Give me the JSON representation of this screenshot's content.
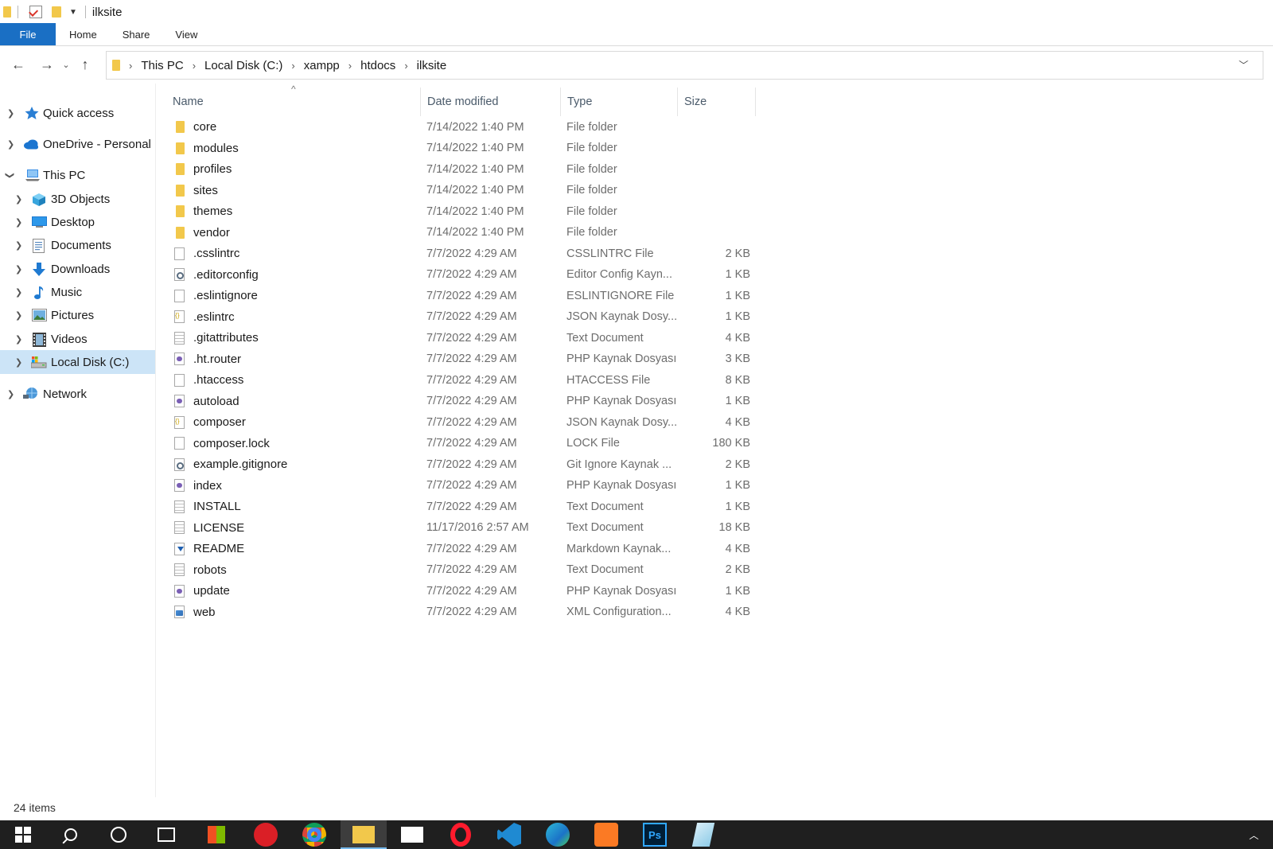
{
  "window": {
    "title": "ilksite"
  },
  "ribbon": {
    "tabs": [
      "File",
      "Home",
      "Share",
      "View"
    ]
  },
  "address": {
    "crumbs": [
      "This PC",
      "Local Disk (C:)",
      "xampp",
      "htdocs",
      "ilksite"
    ]
  },
  "sidebar": {
    "items": [
      {
        "label": "Quick access",
        "icon": "star-icon"
      },
      {
        "label": "OneDrive - Personal",
        "icon": "cloud-icon"
      },
      {
        "label": "This PC",
        "icon": "computer-icon"
      },
      {
        "label": "3D Objects",
        "icon": "cube-icon"
      },
      {
        "label": "Desktop",
        "icon": "desktop-icon"
      },
      {
        "label": "Documents",
        "icon": "documents-icon"
      },
      {
        "label": "Downloads",
        "icon": "download-icon"
      },
      {
        "label": "Music",
        "icon": "music-icon"
      },
      {
        "label": "Pictures",
        "icon": "pictures-icon"
      },
      {
        "label": "Videos",
        "icon": "videos-icon"
      },
      {
        "label": "Local Disk (C:)",
        "icon": "drive-icon"
      },
      {
        "label": "Network",
        "icon": "network-icon"
      }
    ],
    "selected": "Local Disk (C:)"
  },
  "list": {
    "columns": [
      "Name",
      "Date modified",
      "Type",
      "Size"
    ],
    "rows": [
      {
        "name": "core",
        "date": "7/14/2022 1:40 PM",
        "type": "File folder",
        "size": "",
        "icon": "folder"
      },
      {
        "name": "modules",
        "date": "7/14/2022 1:40 PM",
        "type": "File folder",
        "size": "",
        "icon": "folder"
      },
      {
        "name": "profiles",
        "date": "7/14/2022 1:40 PM",
        "type": "File folder",
        "size": "",
        "icon": "folder"
      },
      {
        "name": "sites",
        "date": "7/14/2022 1:40 PM",
        "type": "File folder",
        "size": "",
        "icon": "folder"
      },
      {
        "name": "themes",
        "date": "7/14/2022 1:40 PM",
        "type": "File folder",
        "size": "",
        "icon": "folder"
      },
      {
        "name": "vendor",
        "date": "7/14/2022 1:40 PM",
        "type": "File folder",
        "size": "",
        "icon": "folder"
      },
      {
        "name": ".csslintrc",
        "date": "7/7/2022 4:29 AM",
        "type": "CSSLINTRC File",
        "size": "2 KB",
        "icon": "file"
      },
      {
        "name": ".editorconfig",
        "date": "7/7/2022 4:29 AM",
        "type": "Editor Config Kayn...",
        "size": "1 KB",
        "icon": "gear"
      },
      {
        "name": ".eslintignore",
        "date": "7/7/2022 4:29 AM",
        "type": "ESLINTIGNORE File",
        "size": "1 KB",
        "icon": "file"
      },
      {
        "name": ".eslintrc",
        "date": "7/7/2022 4:29 AM",
        "type": "JSON Kaynak Dosy...",
        "size": "1 KB",
        "icon": "json"
      },
      {
        "name": ".gitattributes",
        "date": "7/7/2022 4:29 AM",
        "type": "Text Document",
        "size": "4 KB",
        "icon": "text"
      },
      {
        "name": ".ht.router",
        "date": "7/7/2022 4:29 AM",
        "type": "PHP Kaynak Dosyası",
        "size": "3 KB",
        "icon": "php"
      },
      {
        "name": ".htaccess",
        "date": "7/7/2022 4:29 AM",
        "type": "HTACCESS File",
        "size": "8 KB",
        "icon": "file"
      },
      {
        "name": "autoload",
        "date": "7/7/2022 4:29 AM",
        "type": "PHP Kaynak Dosyası",
        "size": "1 KB",
        "icon": "php"
      },
      {
        "name": "composer",
        "date": "7/7/2022 4:29 AM",
        "type": "JSON Kaynak Dosy...",
        "size": "4 KB",
        "icon": "json"
      },
      {
        "name": "composer.lock",
        "date": "7/7/2022 4:29 AM",
        "type": "LOCK File",
        "size": "180 KB",
        "icon": "file"
      },
      {
        "name": "example.gitignore",
        "date": "7/7/2022 4:29 AM",
        "type": "Git Ignore Kaynak ...",
        "size": "2 KB",
        "icon": "gear"
      },
      {
        "name": "index",
        "date": "7/7/2022 4:29 AM",
        "type": "PHP Kaynak Dosyası",
        "size": "1 KB",
        "icon": "php"
      },
      {
        "name": "INSTALL",
        "date": "7/7/2022 4:29 AM",
        "type": "Text Document",
        "size": "1 KB",
        "icon": "text"
      },
      {
        "name": "LICENSE",
        "date": "11/17/2016 2:57 AM",
        "type": "Text Document",
        "size": "18 KB",
        "icon": "text"
      },
      {
        "name": "README",
        "date": "7/7/2022 4:29 AM",
        "type": "Markdown Kaynak...",
        "size": "4 KB",
        "icon": "md"
      },
      {
        "name": "robots",
        "date": "7/7/2022 4:29 AM",
        "type": "Text Document",
        "size": "2 KB",
        "icon": "text"
      },
      {
        "name": "update",
        "date": "7/7/2022 4:29 AM",
        "type": "PHP Kaynak Dosyası",
        "size": "1 KB",
        "icon": "php"
      },
      {
        "name": "web",
        "date": "7/7/2022 4:29 AM",
        "type": "XML Configuration...",
        "size": "4 KB",
        "icon": "xml"
      }
    ]
  },
  "status": {
    "count": "24 items"
  },
  "taskbar": {
    "apps": [
      {
        "name": "start",
        "color": "#ffffff"
      },
      {
        "name": "search",
        "color": "#ffffff"
      },
      {
        "name": "cortana",
        "color": "#ffffff"
      },
      {
        "name": "task-view",
        "color": "#ffffff"
      },
      {
        "name": "microsoft-store",
        "color": "#f25022"
      },
      {
        "name": "creative-cloud",
        "color": "#da1f26"
      },
      {
        "name": "chrome",
        "color": "#4285f4"
      },
      {
        "name": "file-explorer",
        "color": "#f2c84b",
        "active": true
      },
      {
        "name": "mail",
        "color": "#ffffff"
      },
      {
        "name": "opera",
        "color": "#ff1b2d"
      },
      {
        "name": "vscode",
        "color": "#1f8ad2"
      },
      {
        "name": "edge",
        "color": "#2ebbd7"
      },
      {
        "name": "xampp",
        "color": "#fb7a24"
      },
      {
        "name": "photoshop",
        "color": "#31a8ff"
      },
      {
        "name": "notepad",
        "color": "#8fcce8"
      }
    ]
  }
}
